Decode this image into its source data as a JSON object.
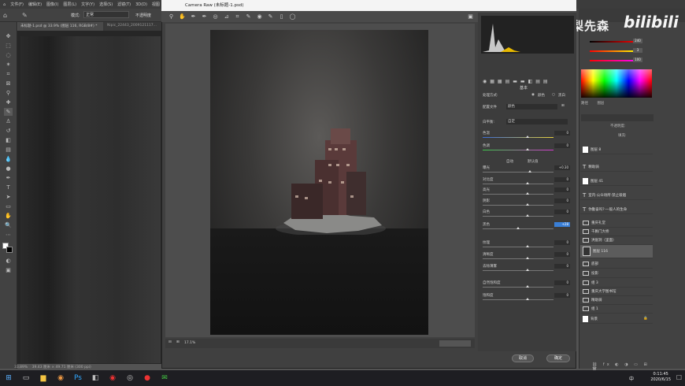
{
  "menubar": {
    "items": [
      "文件(F)",
      "编辑(E)",
      "图像(I)",
      "图层(L)",
      "文字(Y)",
      "选择(S)",
      "滤镜(T)",
      "3D(D)",
      "视图"
    ]
  },
  "options": {
    "mode_label": "模式:",
    "mode_value": "正常",
    "opacity_label": "不透明度"
  },
  "tabs": [
    "未标题-1.psd @ 33.9% (图层 116, RGB/8#) *",
    "Nipic_22443_2009121117..."
  ],
  "status": {
    "zoom": "33.89%",
    "doc": "39.43 厘米 × 49.71 厘米 (300 ppi)"
  },
  "watermark": {
    "text": "做设计的梨先森",
    "bili": "bilibili"
  },
  "color": {
    "r": "240",
    "g": "3",
    "b": "100"
  },
  "layers_header": {
    "tab1": "路径",
    "tab2": "图层",
    "opacity_label": "不透明度:",
    "fill_label": "填充:"
  },
  "layers": [
    {
      "name": "图层 8",
      "type": "pixel"
    },
    {
      "name": "精助骑",
      "type": "text"
    },
    {
      "name": "图层 41",
      "type": "pixel"
    },
    {
      "name": "室内·公众场所·禁止吸烟",
      "type": "text"
    },
    {
      "name": "你勤奋吗?·一般人的生命",
      "type": "text"
    },
    {
      "name": "重庆礼堂",
      "type": "folder"
    },
    {
      "name": "千厮门大桥",
      "type": "folder"
    },
    {
      "name": "洪崖洞（里面）",
      "type": "folder"
    },
    {
      "name": "图层 116",
      "type": "pixel",
      "selected": true
    },
    {
      "name": "底部",
      "type": "folder"
    },
    {
      "name": "投影",
      "type": "folder"
    },
    {
      "name": "组 3",
      "type": "folder"
    },
    {
      "name": "重庆大学图书馆",
      "type": "folder"
    },
    {
      "name": "精助骑",
      "type": "folder"
    },
    {
      "name": "组 1",
      "type": "folder"
    },
    {
      "name": "背景",
      "type": "pixel"
    }
  ],
  "camera_raw": {
    "title": "Camera Raw (未标题-1.psd)",
    "tab_basic": "基本",
    "treatment_label": "处理方式:",
    "treatment_color": "颜色",
    "treatment_bw": "黑白",
    "profile_label": "配置文件",
    "profile_value": "颜色",
    "wb_label": "白平衡:",
    "wb_value": "自定",
    "auto_label": "自动",
    "default_label": "默认值",
    "sliders": [
      {
        "label": "色温",
        "value": "0"
      },
      {
        "label": "色调",
        "value": "0"
      },
      {
        "label": "曝光",
        "value": "+0.30"
      },
      {
        "label": "对比度",
        "value": "0"
      },
      {
        "label": "高光",
        "value": "0"
      },
      {
        "label": "阴影",
        "value": "0"
      },
      {
        "label": "白色",
        "value": "0"
      },
      {
        "label": "黑色",
        "value": "+28",
        "highlight": true
      },
      {
        "label": "纹理",
        "value": "0"
      },
      {
        "label": "清晰度",
        "value": "0"
      },
      {
        "label": "去除薄雾",
        "value": "0"
      },
      {
        "label": "自然饱和度",
        "value": "0"
      },
      {
        "label": "饱和度",
        "value": "0"
      }
    ],
    "zoom_value": "17.1%",
    "cancel": "取消",
    "ok": "确定"
  },
  "taskbar": {
    "time": "0:11:45",
    "date": "2020/6/15",
    "lang": "中"
  }
}
